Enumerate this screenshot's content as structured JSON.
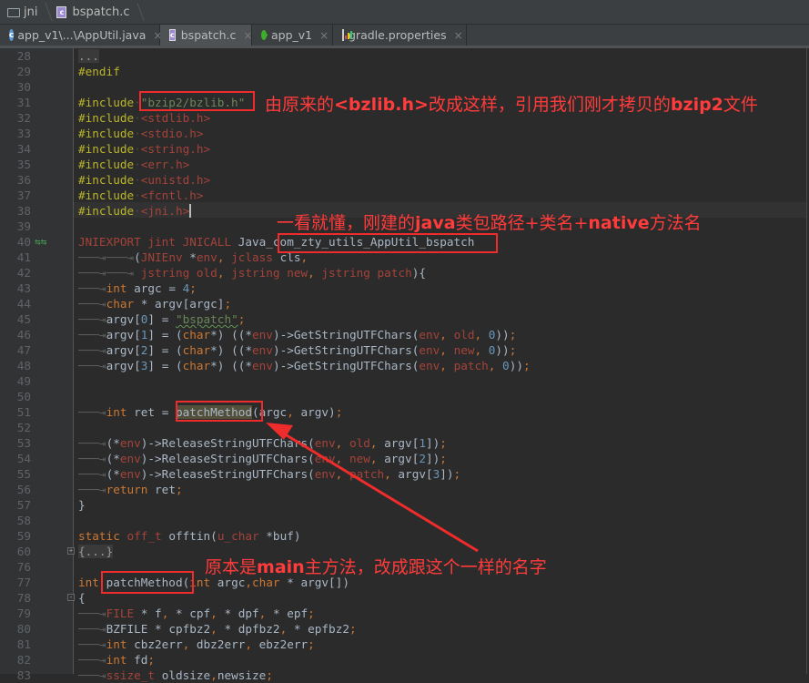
{
  "breadcrumb": {
    "items": [
      {
        "label": "jni",
        "icon": "folder-icon"
      },
      {
        "label": "bspatch.c",
        "icon": "c-file-icon"
      }
    ]
  },
  "tabs": [
    {
      "label": "app_v1\\...\\AppUtil.java",
      "icon": "java-class-icon",
      "active": false
    },
    {
      "label": "bspatch.c",
      "icon": "c-file-icon",
      "active": true
    },
    {
      "label": "app_v1",
      "icon": "module-icon",
      "active": false
    },
    {
      "label": "gradle.properties",
      "icon": "gradle-properties-icon",
      "active": false
    }
  ],
  "tab_close_glyph": "×",
  "editor": {
    "lines": [
      {
        "n": "28",
        "text": "..."
      },
      {
        "n": "29",
        "text": "#endif"
      },
      {
        "n": "30",
        "text": ""
      },
      {
        "n": "31",
        "text": "#include \"bzip2/bzlib.h\""
      },
      {
        "n": "32",
        "text": "#include <stdlib.h>"
      },
      {
        "n": "33",
        "text": "#include <stdio.h>"
      },
      {
        "n": "34",
        "text": "#include <string.h>"
      },
      {
        "n": "35",
        "text": "#include <err.h>"
      },
      {
        "n": "36",
        "text": "#include <unistd.h>"
      },
      {
        "n": "37",
        "text": "#include <fcntl.h>"
      },
      {
        "n": "38",
        "text": "#include <jni.h>"
      },
      {
        "n": "39",
        "text": ""
      },
      {
        "n": "40",
        "text": "JNIEXPORT jint JNICALL Java_com_zty_utils_AppUtil_bspatch"
      },
      {
        "n": "41",
        "text": "(JNIEnv *env, jclass cls,"
      },
      {
        "n": "42",
        "text": " jstring old, jstring new, jstring patch){"
      },
      {
        "n": "43",
        "text": "int argc = 4;"
      },
      {
        "n": "44",
        "text": "char * argv[argc];"
      },
      {
        "n": "45",
        "text": "argv[0] = \"bspatch\";"
      },
      {
        "n": "46",
        "text": "argv[1] = (char*) ((*env)->GetStringUTFChars(env, old, 0));"
      },
      {
        "n": "47",
        "text": "argv[2] = (char*) ((*env)->GetStringUTFChars(env, new, 0));"
      },
      {
        "n": "48",
        "text": "argv[3] = (char*) ((*env)->GetStringUTFChars(env, patch, 0));"
      },
      {
        "n": "49",
        "text": ""
      },
      {
        "n": "50",
        "text": ""
      },
      {
        "n": "51",
        "text": "int ret = patchMethod(argc, argv);"
      },
      {
        "n": "52",
        "text": ""
      },
      {
        "n": "53",
        "text": "(*env)->ReleaseStringUTFChars(env, old, argv[1]);"
      },
      {
        "n": "54",
        "text": "(*env)->ReleaseStringUTFChars(env, new, argv[2]);"
      },
      {
        "n": "55",
        "text": "(*env)->ReleaseStringUTFChars(env, patch, argv[3]);"
      },
      {
        "n": "56",
        "text": "return ret;"
      },
      {
        "n": "57",
        "text": "}"
      },
      {
        "n": "58",
        "text": ""
      },
      {
        "n": "59",
        "text": "static off_t offtin(u_char *buf)"
      },
      {
        "n": "60",
        "text": "{...}"
      },
      {
        "n": "76",
        "text": ""
      },
      {
        "n": "77",
        "text": "int patchMethod(int argc,char * argv[])"
      },
      {
        "n": "78",
        "text": "{"
      },
      {
        "n": "79",
        "text": "FILE * f, * cpf, * dpf, * epf;"
      },
      {
        "n": "80",
        "text": "BZFILE * cpfbz2, * dpfbz2, * epfbz2;"
      },
      {
        "n": "81",
        "text": "int cbz2err, dbz2err, ebz2err;"
      },
      {
        "n": "82",
        "text": "int fd;"
      },
      {
        "n": "83",
        "text": "ssize_t oldsize,newsize;"
      }
    ]
  },
  "annotations": [
    {
      "id": "include-note",
      "text_parts": [
        "由原来的",
        "<bzlib.h>",
        "改成这样，引用我们刚才拷贝的",
        "bzip2",
        "文件"
      ]
    },
    {
      "id": "jni-name-note",
      "text_parts": [
        "一看就懂，刚建的",
        "java",
        "类包路径+类名+",
        "native",
        "方法名"
      ]
    },
    {
      "id": "main-rename-note",
      "text_parts": [
        "原本是",
        "main",
        "主方法，改成跟这个一样的名字"
      ]
    }
  ],
  "colors": {
    "annotation_red": "#ee2c2c",
    "editor_bg": "#2b2b2b",
    "keyword": "#cc7832",
    "string": "#6a8759",
    "preprocessor": "#bbb529"
  }
}
